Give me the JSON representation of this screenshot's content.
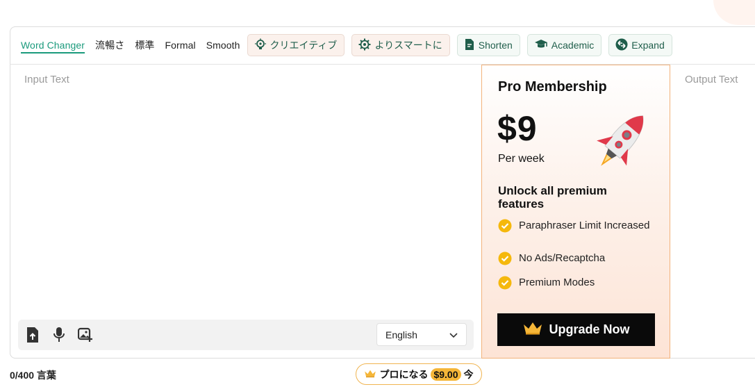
{
  "modes": {
    "word_changer": "Word Changer",
    "fluency": "流暢さ",
    "standard": "標準",
    "formal": "Formal",
    "smooth": "Smooth",
    "creative": "クリエイティブ",
    "smarter": "よりスマートに",
    "shorten": "Shorten",
    "academic": "Academic",
    "expand": "Expand"
  },
  "input": {
    "label": "Input Text",
    "language": "English"
  },
  "output": {
    "label": "Output Text"
  },
  "promo": {
    "title": "Pro Membership",
    "price": "$9",
    "period": "Per week",
    "unlock": "Unlock all premium features",
    "features": [
      "Paraphraser Limit Increased",
      "No Ads/Recaptcha",
      "Premium Modes"
    ],
    "upgrade_label": "Upgrade Now"
  },
  "footer": {
    "word_count": "0/400 言葉",
    "pro_label": "プロになる",
    "pro_price": "$9.00",
    "pro_suffix": "今"
  },
  "colors": {
    "accent_green": "#1a9a7c",
    "promo_border": "#f2b27a",
    "crown_gold": "#f5b638",
    "check_gold": "#f5b80c"
  },
  "icons": {
    "creative": "lightbulb-icon",
    "smarter": "gear-brain-icon",
    "shorten": "document-icon",
    "academic": "graduation-cap-icon",
    "expand": "expand-arrows-icon",
    "upload": "file-upload-icon",
    "mic": "microphone-icon",
    "image": "image-add-icon",
    "dropdown": "chevron-down-icon",
    "crown": "crown-icon",
    "check": "check-badge-icon"
  }
}
